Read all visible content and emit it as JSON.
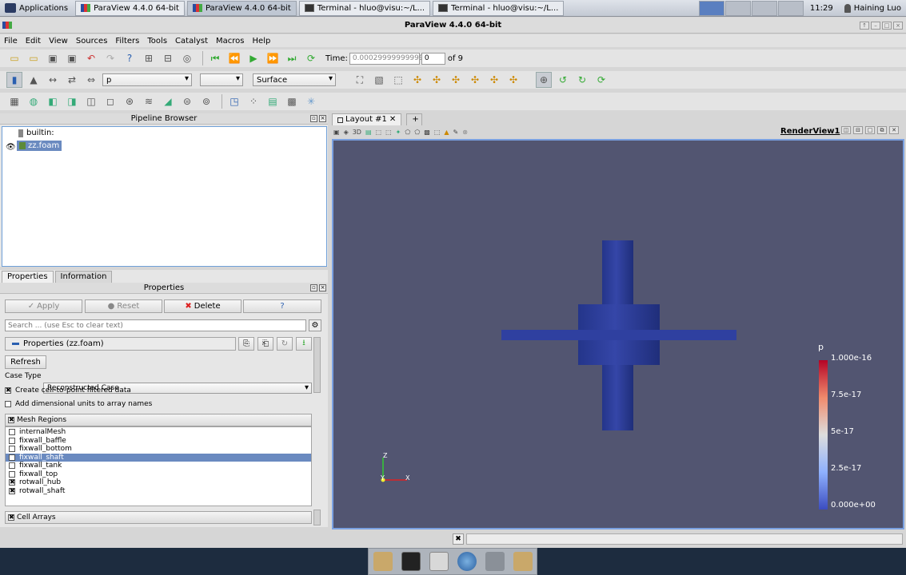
{
  "system_panel": {
    "apps_label": "Applications",
    "tasks": [
      {
        "label": "ParaView 4.4.0 64-bit",
        "icon": "paraview-icon"
      },
      {
        "label": "ParaView 4.4.0 64-bit",
        "icon": "paraview-icon"
      },
      {
        "label": "Terminal - hluo@visu:~/L...",
        "icon": "terminal-icon"
      },
      {
        "label": "Terminal - hluo@visu:~/L...",
        "icon": "terminal-icon"
      }
    ],
    "clock": "11:29",
    "user": "Haining Luo"
  },
  "window": {
    "title": "ParaView 4.4.0 64-bit"
  },
  "menu": [
    "File",
    "Edit",
    "View",
    "Sources",
    "Filters",
    "Tools",
    "Catalyst",
    "Macros",
    "Help"
  ],
  "time_toolbar": {
    "time_label": "Time:",
    "time_value": "0.00029999999999",
    "step_value": "0",
    "of_label": "of 9"
  },
  "display_toolbar": {
    "color_array": "p",
    "component": "",
    "representation": "Surface"
  },
  "pipeline": {
    "title": "Pipeline Browser",
    "items": [
      {
        "label": "builtin:"
      },
      {
        "label": "zz.foam"
      }
    ]
  },
  "properties": {
    "tabs": [
      "Properties",
      "Information"
    ],
    "title": "Properties",
    "apply": "Apply",
    "reset": "Reset",
    "delete": "Delete",
    "help": "?",
    "search_placeholder": "Search ... (use Esc to clear text)",
    "section": "Properties (zz.foam)",
    "refresh": "Refresh",
    "case_type_label": "Case Type",
    "case_type_value": "Reconstructed Case",
    "opt1": "Create cell-to-point filtered data",
    "opt2": "Add dimensional units to array names",
    "mesh_regions_header": "Mesh Regions",
    "mesh_regions": [
      {
        "label": "internalMesh",
        "checked": false
      },
      {
        "label": "fixwall_baffle",
        "checked": false
      },
      {
        "label": "fixwall_bottom",
        "checked": false
      },
      {
        "label": "fixwall_shaft",
        "checked": false
      },
      {
        "label": "fixwall_tank",
        "checked": false
      },
      {
        "label": "fixwall_top",
        "checked": false
      },
      {
        "label": "rotwall_hub",
        "checked": true
      },
      {
        "label": "rotwall_shaft",
        "checked": true
      }
    ],
    "cell_arrays_header": "Cell Arrays"
  },
  "layout": {
    "tab": "Layout #1",
    "add": "+",
    "view_name": "RenderView1",
    "three_d": "3D"
  },
  "colorbar": {
    "title": "p",
    "labels": [
      "1.000e-16",
      "7.5e-17",
      "5e-17",
      "2.5e-17",
      "0.000e+00"
    ]
  },
  "axes": {
    "z": "Z",
    "y": "Y",
    "x": "X"
  },
  "colors": {
    "render_bg": "#525571",
    "object": "#2e3f9e",
    "accent": "#6a8ac0"
  }
}
